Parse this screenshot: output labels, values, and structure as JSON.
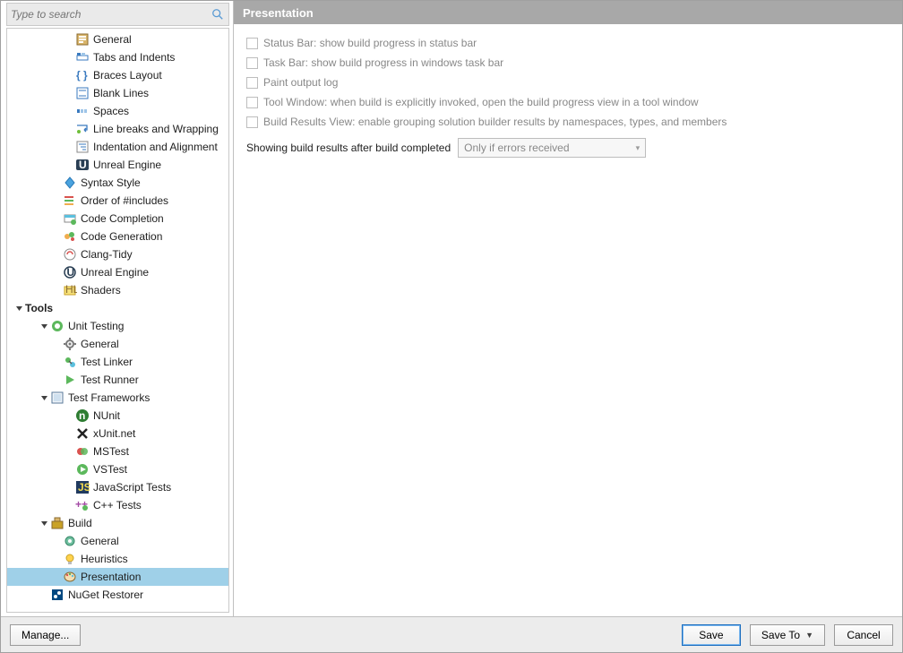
{
  "search": {
    "placeholder": "Type to search"
  },
  "content": {
    "title": "Presentation",
    "options": [
      {
        "label": "Status Bar: show build progress in status bar",
        "checked": false
      },
      {
        "label": "Task Bar: show build progress in windows task bar",
        "checked": false
      },
      {
        "label": "Paint output log",
        "checked": false
      },
      {
        "label": "Tool Window: when build is explicitly invoked, open the build progress view in a tool window",
        "checked": false
      },
      {
        "label": "Build Results View: enable grouping solution builder results by namespaces, types, and members",
        "checked": false
      }
    ],
    "dropdown": {
      "label": "Showing build results after build completed",
      "value": "Only if errors received"
    }
  },
  "footer": {
    "manage": "Manage...",
    "save": "Save",
    "saveTo": "Save To",
    "cancel": "Cancel"
  },
  "tree": [
    {
      "d": 4,
      "icon": "general",
      "label": "General"
    },
    {
      "d": 4,
      "icon": "tabs",
      "label": "Tabs and Indents"
    },
    {
      "d": 4,
      "icon": "braces",
      "label": "Braces Layout"
    },
    {
      "d": 4,
      "icon": "blank",
      "label": "Blank Lines"
    },
    {
      "d": 4,
      "icon": "spaces",
      "label": "Spaces"
    },
    {
      "d": 4,
      "icon": "wrap",
      "label": "Line breaks and Wrapping"
    },
    {
      "d": 4,
      "icon": "indent",
      "label": "Indentation and Alignment"
    },
    {
      "d": 4,
      "icon": "unreal",
      "label": "Unreal Engine"
    },
    {
      "d": 3,
      "icon": "syntax",
      "label": "Syntax Style"
    },
    {
      "d": 3,
      "icon": "order",
      "label": "Order of #includes"
    },
    {
      "d": 3,
      "icon": "completion",
      "label": "Code Completion"
    },
    {
      "d": 3,
      "icon": "generation",
      "label": "Code Generation"
    },
    {
      "d": 3,
      "icon": "clang",
      "label": "Clang-Tidy"
    },
    {
      "d": 3,
      "icon": "unreal2",
      "label": "Unreal Engine"
    },
    {
      "d": 3,
      "icon": "shaders",
      "label": "Shaders"
    },
    {
      "d": 0,
      "expander": "open",
      "bold": true,
      "label": "Tools"
    },
    {
      "d": 2,
      "expander": "open",
      "icon": "unit",
      "label": "Unit Testing"
    },
    {
      "d": 3,
      "icon": "gear",
      "label": "General"
    },
    {
      "d": 3,
      "icon": "linker",
      "label": "Test Linker"
    },
    {
      "d": 3,
      "icon": "runner",
      "label": "Test Runner"
    },
    {
      "d": 2,
      "expander": "open",
      "icon": "frameworks",
      "label": "Test Frameworks"
    },
    {
      "d": 4,
      "icon": "nunit",
      "label": "NUnit"
    },
    {
      "d": 4,
      "icon": "xunit",
      "label": "xUnit.net"
    },
    {
      "d": 4,
      "icon": "mstest",
      "label": "MSTest"
    },
    {
      "d": 4,
      "icon": "vstest",
      "label": "VSTest"
    },
    {
      "d": 4,
      "icon": "js",
      "label": "JavaScript Tests"
    },
    {
      "d": 4,
      "icon": "cpp",
      "label": "C++ Tests"
    },
    {
      "d": 2,
      "expander": "open",
      "icon": "build",
      "label": "Build"
    },
    {
      "d": 3,
      "icon": "gear2",
      "label": "General"
    },
    {
      "d": 3,
      "icon": "bulb",
      "label": "Heuristics"
    },
    {
      "d": 3,
      "icon": "palette",
      "label": "Presentation",
      "selected": true
    },
    {
      "d": 2,
      "icon": "nuget",
      "label": "NuGet Restorer"
    }
  ]
}
